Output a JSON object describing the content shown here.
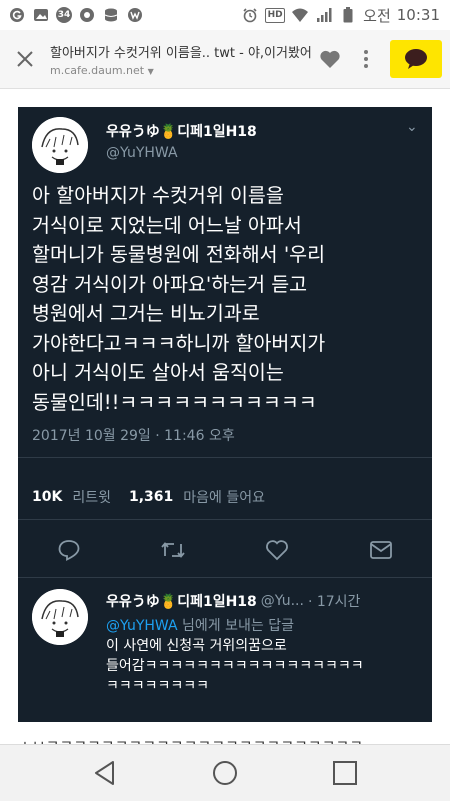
{
  "status_bar": {
    "left_icons": [
      "g-circle-icon",
      "photo-icon",
      "notification-badge-icon",
      "record-icon",
      "database-icon",
      "w-circle-icon"
    ],
    "badge_number": "34",
    "ampm": "오전",
    "time": "10:31",
    "hd_label": "HD"
  },
  "browser": {
    "page_title": "할아버지가 수컷거위 이름을.. twt - 야,이거봤어?...",
    "host": "m.cafe.daum.net",
    "kakao_color": "#fee500"
  },
  "tweet": {
    "author_name": "우유うゆ🍍디페1일H18",
    "author_handle": "@YuYHWA",
    "text_lines": [
      "아 할아버지가 수컷거위 이름을",
      "거식이로 지었는데 어느날 아파서",
      "할머니가 동물병원에 전화해서 '우리",
      "영감 거식이가 아파요'하는거 듣고",
      "병원에서 그거는 비뇨기과로",
      "가야한다고ㅋㅋㅋ하니까 할아버지가",
      "아니 거식이도 살아서 움직이는",
      "동물인데!!ㅋㅋㅋㅋㅋㅋㅋㅋㅋㅋㅋ"
    ],
    "timestamp": "2017년 10월 29일 · 11:46 오후",
    "retweet_count": "10K",
    "retweet_label": "리트윗",
    "like_count": "1,361",
    "like_label": "마음에 들어요"
  },
  "reply": {
    "author_name": "우유うゆ🍍디페1일H18",
    "author_handle": "@Yu...",
    "time_ago": "· 17시간",
    "mention": "@YuYHWA",
    "replying_label": "님에게 보내는 답글",
    "text_lines": [
      "이 사연에 신청곡 거위의꿈으로",
      "들어감ㅋㅋㅋㅋㅋㅋㅋㅋㅋㅋㅋㅋㅋㅋㅋㅋㅋ",
      "ㅋㅋㅋㅋㅋㅋㅋㅋ"
    ]
  },
  "below_text": "ㅅㅂㅋㅋㅋㅋㅋㅋㅋㅋㅋㅋㅋㅋㅋㅋㅋㅋㅋㅋㅋㅋㅋㅋㅋ",
  "nav": {
    "icons": [
      "back-icon",
      "home-icon",
      "recents-icon"
    ]
  },
  "colors": {
    "tweet_bg": "#15202b",
    "muted": "#8899a6",
    "link": "#1da1f2"
  }
}
